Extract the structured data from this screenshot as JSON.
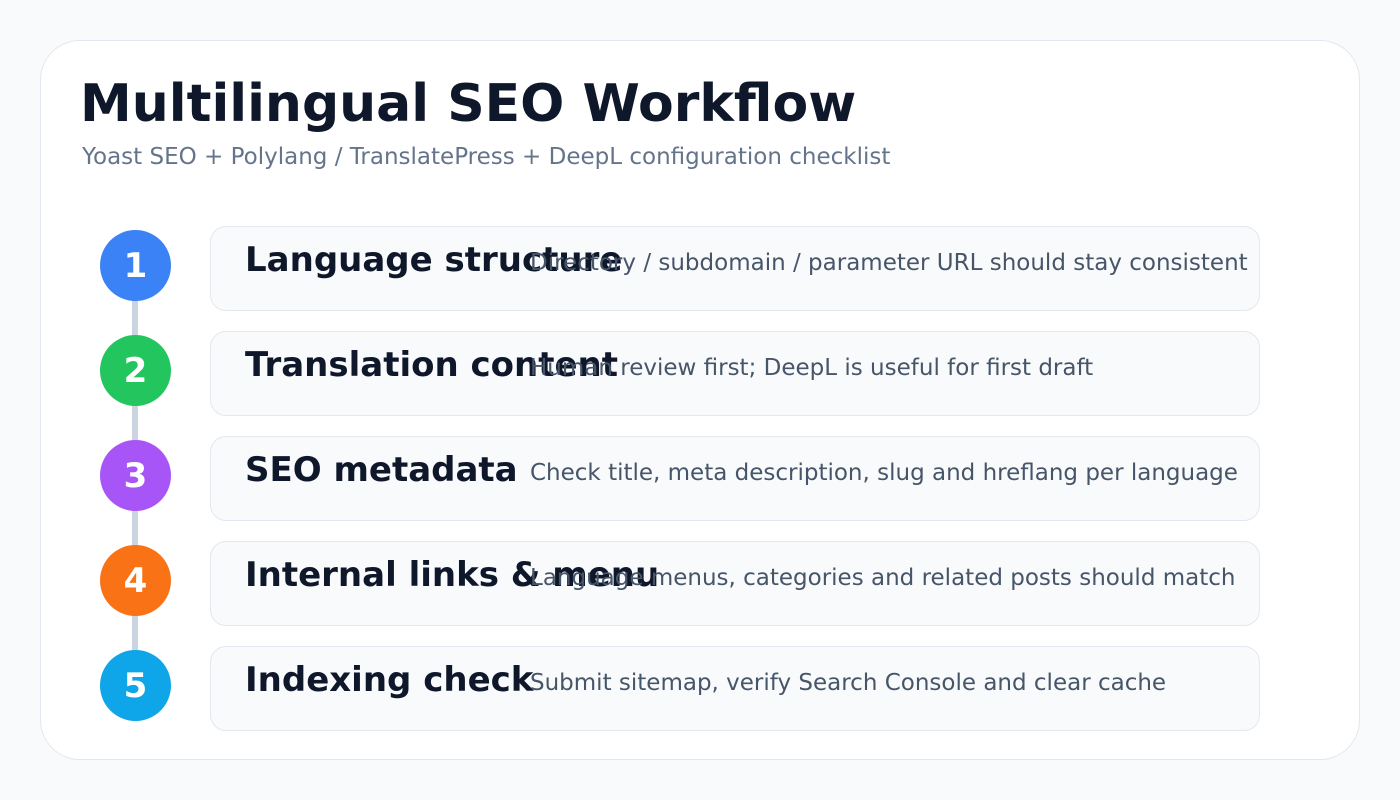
{
  "header": {
    "title": "Multilingual SEO Workflow",
    "subtitle": "Yoast SEO + Polylang / TranslatePress + DeepL configuration checklist"
  },
  "steps": [
    {
      "number": "1",
      "title": "Language structure",
      "description": "Directory / subdomain / parameter URL should stay consistent",
      "color": "#3b82f6"
    },
    {
      "number": "2",
      "title": "Translation content",
      "description": "Human review first; DeepL is useful for first draft",
      "color": "#22c55e"
    },
    {
      "number": "3",
      "title": "SEO metadata",
      "description": "Check title, meta description, slug and hreflang per language",
      "color": "#a855f7"
    },
    {
      "number": "4",
      "title": "Internal links & menu",
      "description": "Language menus, categories and related posts should match",
      "color": "#f97316"
    },
    {
      "number": "5",
      "title": "Indexing check",
      "description": "Submit sitemap, verify Search Console and clear cache",
      "color": "#0ea5e9"
    }
  ]
}
